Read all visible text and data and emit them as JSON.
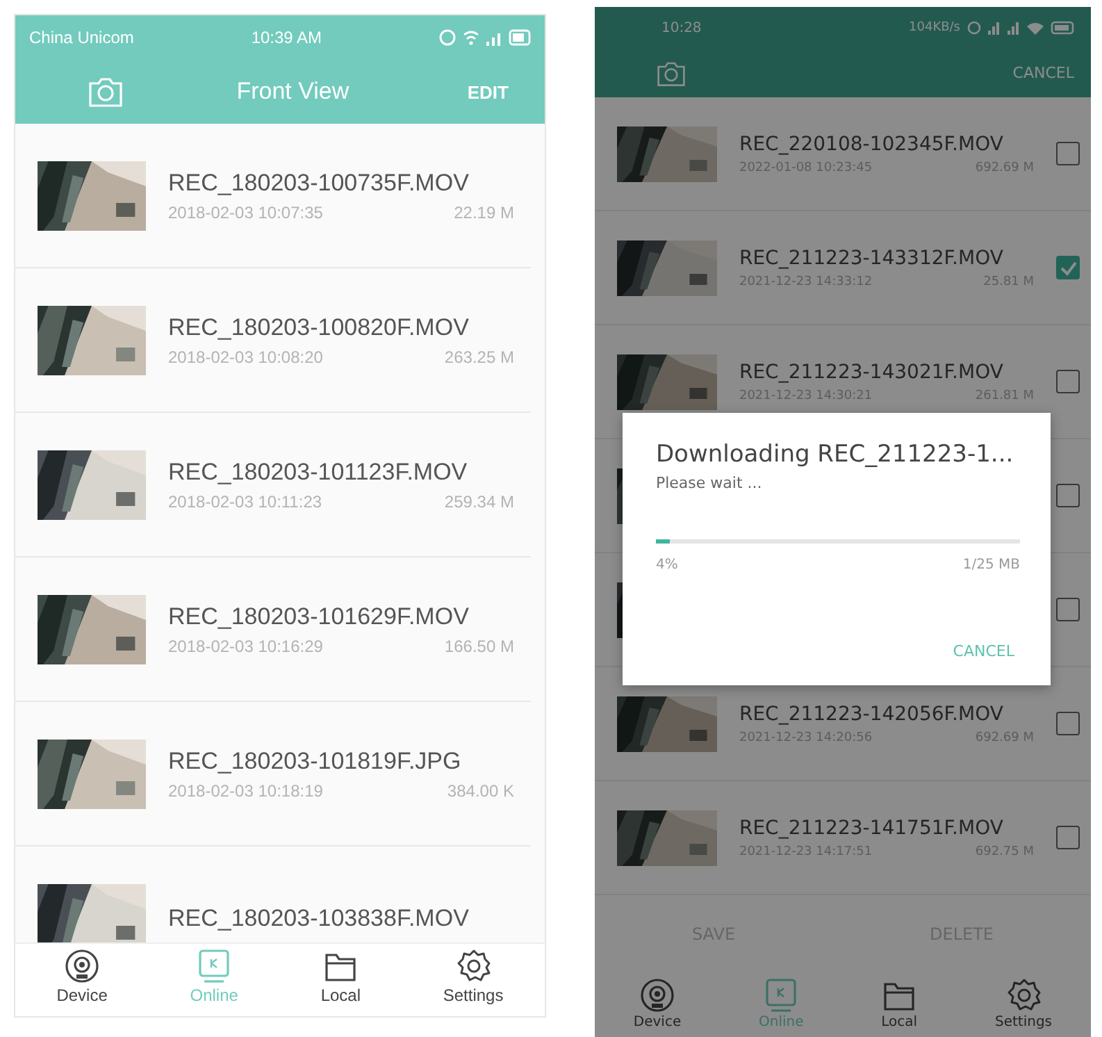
{
  "left_screen": {
    "status_bar": {
      "carrier": "China Unicom",
      "time": "10:39 AM"
    },
    "header": {
      "title": "Front View",
      "action": "EDIT"
    },
    "files": [
      {
        "name": "REC_180203-100735F.MOV",
        "date": "2018-02-03 10:07:35",
        "size": "22.19 M"
      },
      {
        "name": "REC_180203-100820F.MOV",
        "date": "2018-02-03 10:08:20",
        "size": "263.25 M"
      },
      {
        "name": "REC_180203-101123F.MOV",
        "date": "2018-02-03 10:11:23",
        "size": "259.34 M"
      },
      {
        "name": "REC_180203-101629F.MOV",
        "date": "2018-02-03 10:16:29",
        "size": "166.50 M"
      },
      {
        "name": "REC_180203-101819F.JPG",
        "date": "2018-02-03 10:18:19",
        "size": "384.00 K"
      },
      {
        "name": "REC_180203-103838F.MOV"
      }
    ],
    "nav": [
      {
        "kind": "device",
        "label": "Device",
        "selected": false
      },
      {
        "kind": "online",
        "label": "Online",
        "selected": true
      },
      {
        "kind": "local",
        "label": "Local",
        "selected": false
      },
      {
        "kind": "settings",
        "label": "Settings",
        "selected": false
      }
    ]
  },
  "right_screen": {
    "status_bar": {
      "time": "10:28",
      "net_speed": "104KB/s"
    },
    "header": {
      "action": "CANCEL"
    },
    "files": [
      {
        "name": "REC_220108-102345F.MOV",
        "date": "2022-01-08 10:23:45",
        "size": "692.69 M",
        "checked": false
      },
      {
        "name": "REC_211223-143312F.MOV",
        "date": "2021-12-23 14:33:12",
        "size": "25.81 M",
        "checked": true
      },
      {
        "name": "REC_211223-143021F.MOV",
        "date": "2021-12-23 14:30:21",
        "size": "261.81 M",
        "checked": false
      },
      {
        "checked": false
      },
      {
        "checked": false
      },
      {
        "name": "REC_211223-142056F.MOV",
        "date": "2021-12-23 14:20:56",
        "size": "692.69 M",
        "checked": false
      },
      {
        "name": "REC_211223-141751F.MOV",
        "date": "2021-12-23 14:17:51",
        "size": "692.75 M",
        "checked": false
      }
    ],
    "actions": [
      "SAVE",
      "DELETE"
    ],
    "nav": [
      {
        "kind": "device",
        "label": "Device",
        "selected": false
      },
      {
        "kind": "online",
        "label": "Online",
        "selected": true
      },
      {
        "kind": "local",
        "label": "Local",
        "selected": false
      },
      {
        "kind": "settings",
        "label": "Settings",
        "selected": false
      }
    ],
    "dialog": {
      "title": "Downloading REC_211223-1...",
      "message": "Please wait ...",
      "level": 0.04,
      "percent": "4%",
      "amount": "1/25 MB",
      "button": "CANCEL"
    }
  }
}
